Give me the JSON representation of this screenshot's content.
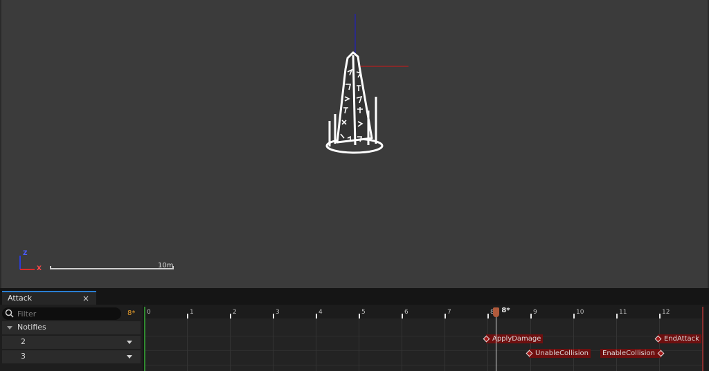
{
  "viewport": {
    "scale_label": "10m",
    "axis_z": "Z",
    "axis_x": "X",
    "colors": {
      "background": "#3b3b3b",
      "x_axis": "#d11a1a",
      "z_axis": "#1a1ad6",
      "mesh": "#ffffff"
    }
  },
  "panel": {
    "tab_label": "Attack",
    "tab_close": "×",
    "filter": {
      "placeholder": "Filter",
      "value": ""
    },
    "frame_badge": "8*",
    "tracks": [
      {
        "label": "Notifies"
      },
      {
        "label": "2"
      },
      {
        "label": "3"
      }
    ]
  },
  "timeline": {
    "ticks": [
      "0",
      "1",
      "2",
      "3",
      "4",
      "5",
      "6",
      "7",
      "8",
      "9",
      "10",
      "11",
      "12"
    ],
    "current_frame_label": "8*",
    "current_frame": 8.2,
    "notifies": [
      {
        "label": "ApplyDamage",
        "lane": 0,
        "frame": 8
      },
      {
        "label": "EndAttack",
        "lane": 0,
        "frame": 12
      },
      {
        "label": "UnableCollision",
        "lane": 1,
        "frame": 9
      },
      {
        "label": "EnableCollision",
        "lane": 1,
        "frame": 12
      }
    ]
  }
}
